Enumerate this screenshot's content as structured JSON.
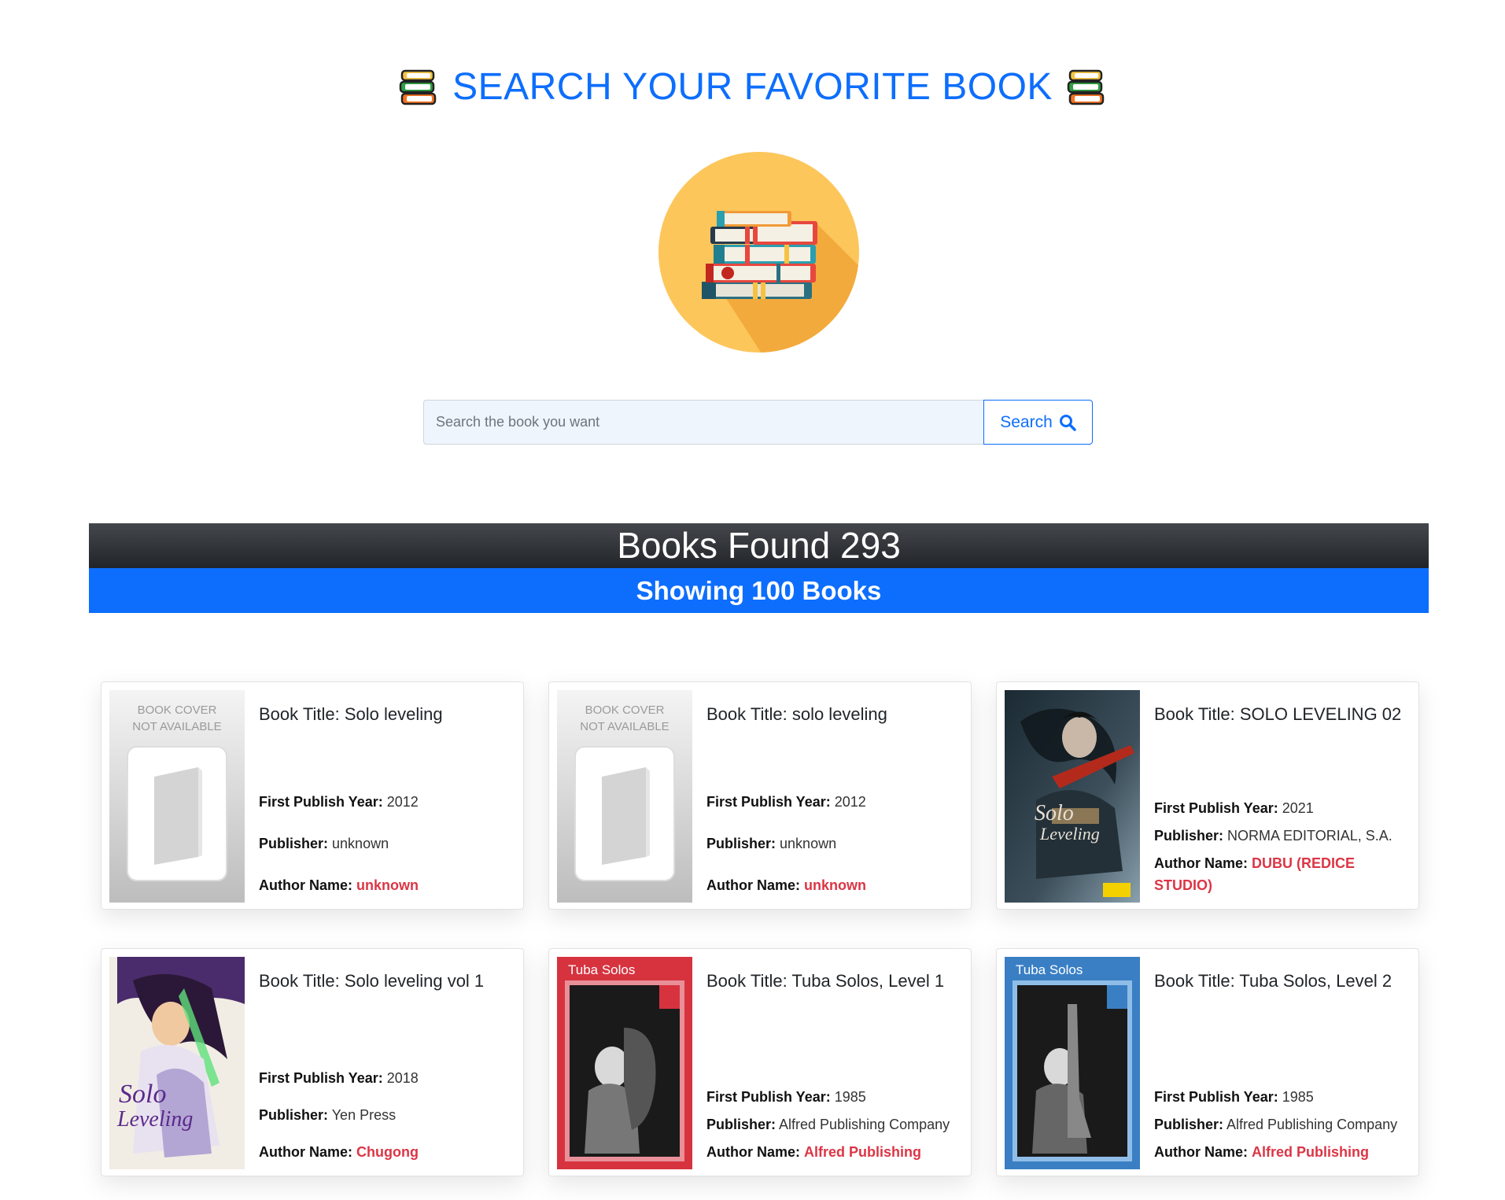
{
  "header": {
    "title": "SEARCH YOUR FAVORITE BOOK",
    "left_icon": "books-icon",
    "right_icon": "books-icon"
  },
  "logo": {
    "icon": "book-stack-logo"
  },
  "search": {
    "placeholder": "Search the book you want",
    "value": "",
    "button_label": "Search",
    "button_icon": "search-icon"
  },
  "summary": {
    "found_text": "Books Found 293",
    "showing_text": "Showing 100 Books"
  },
  "labels": {
    "first_publish_year": "First Publish Year:",
    "publisher": "Publisher:",
    "author_name": "Author Name:"
  },
  "books": [
    {
      "title": "Book Title: Solo leveling",
      "year": "2012",
      "publisher": "unknown",
      "author": "unknown",
      "cover": "not-available",
      "cover_text_1": "BOOK COVER",
      "cover_text_2": "NOT AVAILABLE"
    },
    {
      "title": "Book Title: solo leveling",
      "year": "2012",
      "publisher": "unknown",
      "author": "unknown",
      "cover": "not-available",
      "cover_text_1": "BOOK COVER",
      "cover_text_2": "NOT AVAILABLE"
    },
    {
      "title": "Book Title: SOLO LEVELING 02",
      "year": "2021",
      "publisher": "NORMA EDITORIAL, S.A.",
      "author": "DUBU (REDICE STUDIO)",
      "cover": "solo-leveling-02"
    },
    {
      "title": "Book Title: Solo leveling vol 1",
      "year": "2018",
      "publisher": "Yen Press",
      "author": "Chugong",
      "cover": "solo-leveling-vol1"
    },
    {
      "title": "Book Title: Tuba Solos, Level 1",
      "year": "1985",
      "publisher": "Alfred Publishing Company",
      "author": "Alfred Publishing",
      "cover": "tuba-solos-red",
      "cover_text_1": "Tuba Solos"
    },
    {
      "title": "Book Title: Tuba Solos, Level 2",
      "year": "1985",
      "publisher": "Alfred Publishing Company",
      "author": "Alfred Publishing",
      "cover": "tuba-solos-blue",
      "cover_text_1": "Tuba Solos"
    }
  ],
  "colors": {
    "primary": "#0d6efd",
    "dark_banner": "#212529",
    "author": "#dc3545"
  }
}
